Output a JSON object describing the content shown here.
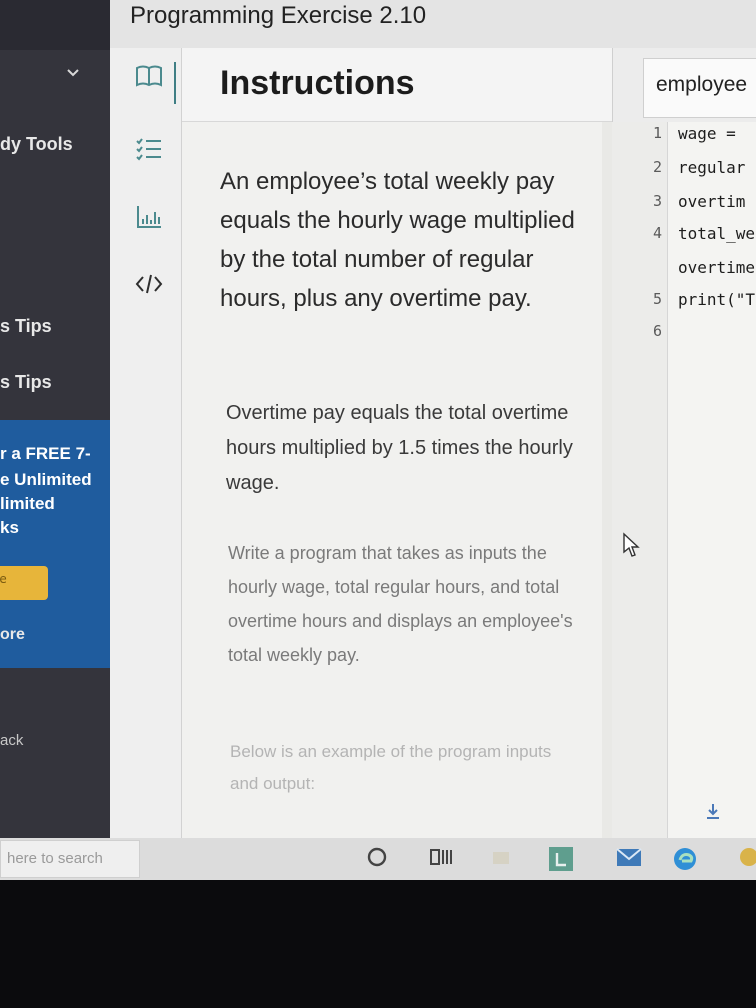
{
  "window": {
    "title": "Programming Exercise 2.10"
  },
  "sidebar": {
    "items": [
      "dy Tools",
      "s Tips",
      "s Tips"
    ],
    "promo_lines": [
      "r a FREE 7-",
      "e Unlimited",
      "limited",
      "ks"
    ],
    "promo_button": "ee",
    "more_label": "ore",
    "back_label": "ack"
  },
  "rail": {
    "icons": [
      "book-icon",
      "checklist-icon",
      "chart-icon",
      "code-icon"
    ]
  },
  "instructions": {
    "title": "Instructions",
    "paragraphs": [
      "An employee’s total weekly pay equals the hourly wage multiplied by the total number of regular hours, plus any overtime pay.",
      "Overtime pay equals the total overtime hours multiplied by 1.5 times the hourly wage.",
      "Write a program that takes as inputs the hourly wage, total regular hours, and total overtime hours and displays an employee's total weekly pay.",
      "Below is an example of the program inputs and output:"
    ]
  },
  "editor": {
    "tab_label": "employee",
    "lines": [
      {
        "n": "1",
        "text": "wage = "
      },
      {
        "n": "2",
        "text": "regular"
      },
      {
        "n": "3",
        "text": "overtim"
      },
      {
        "n": "4",
        "text": "total_we"
      },
      {
        "n": "",
        "text": "overtime"
      },
      {
        "n": "5",
        "text": "print(\"T"
      },
      {
        "n": "6",
        "text": ""
      }
    ]
  },
  "taskbar": {
    "search_placeholder": "here to search"
  },
  "colors": {
    "accent": "#3f7e84",
    "promo": "#1f5c9e",
    "sidebar": "#34343c"
  }
}
